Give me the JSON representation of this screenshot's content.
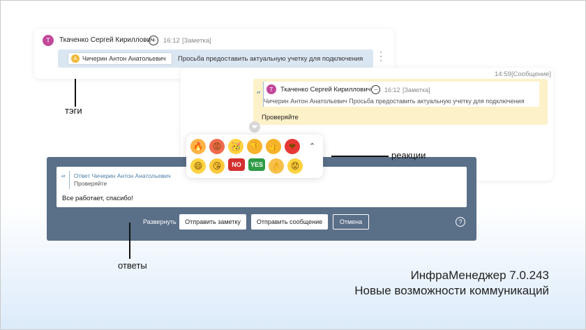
{
  "note_card": {
    "avatar_letter": "Т",
    "author": "Ткаченко Сергей Кириллович",
    "time": "16:12",
    "kind": "[Заметка]",
    "tag": {
      "avatar_letter": "А",
      "name": "Чичерин Антон Анатольевич"
    },
    "text": "Просьба предоставить актуальную учетку для подключения"
  },
  "message_card": {
    "time": "14:59",
    "kind": "[Сообщение]",
    "quote": {
      "avatar_letter": "Т",
      "author": "Ткаченко Сергей Кириллович",
      "time": "16:12",
      "kind": "[Заметка]",
      "tag_name": "Чичерин Антон Анатольевич",
      "text": "Просьба предоставить актуальную учетку для подключения"
    },
    "text": "Проверяйте"
  },
  "reactions": {
    "row1": [
      {
        "name": "fire",
        "glyph": "🔥",
        "bg": "#ffb347"
      },
      {
        "name": "angry",
        "glyph": "😡",
        "bg": "#ef6a4d"
      },
      {
        "name": "party",
        "glyph": "🥳",
        "bg": "#ffd23f"
      },
      {
        "name": "thumbs-down",
        "glyph": "👎",
        "bg": "#f7b32b"
      },
      {
        "name": "thumbs-up",
        "glyph": "👍",
        "bg": "#f7b32b"
      },
      {
        "name": "heart",
        "glyph": "❤",
        "bg": "#e53935"
      }
    ],
    "row2": [
      {
        "name": "grin",
        "glyph": "😄",
        "bg": "#ffd23f"
      },
      {
        "name": "kiss",
        "glyph": "😘",
        "bg": "#ffc93c"
      },
      {
        "name": "no",
        "glyph": "NO",
        "bg": "#d32f2f",
        "word": true
      },
      {
        "name": "yes",
        "glyph": "YES",
        "bg": "#2e9b46",
        "word": true
      },
      {
        "name": "ok-hand",
        "glyph": "👌",
        "bg": "#f7c04a"
      },
      {
        "name": "worried",
        "glyph": "😟",
        "bg": "#ffd23f"
      }
    ]
  },
  "reply_panel": {
    "quote_title": "Ответ Чичерин Антон Анатольевич",
    "quote_text": "Проверяйте",
    "body": "Все работает, спасибо!",
    "expand_label": "Развернуть",
    "send_note_label": "Отправить заметку",
    "send_message_label": "Отправить сообщение",
    "cancel_label": "Отмена",
    "help_label": "?"
  },
  "callouts": {
    "tags": "тэги",
    "reactions": "реакции",
    "replies": "ответы"
  },
  "footer": {
    "line1": "ИнфраМенеджер 7.0.243",
    "line2": "Новые возможности коммуникаций"
  },
  "colors": {
    "avatar_note": "#c2489a",
    "avatar_tag": "#f0b93a",
    "message_bg": "#fdf1c9",
    "reply_panel_bg": "#5a6f88",
    "tag_row_bg": "#dbe6f3"
  }
}
